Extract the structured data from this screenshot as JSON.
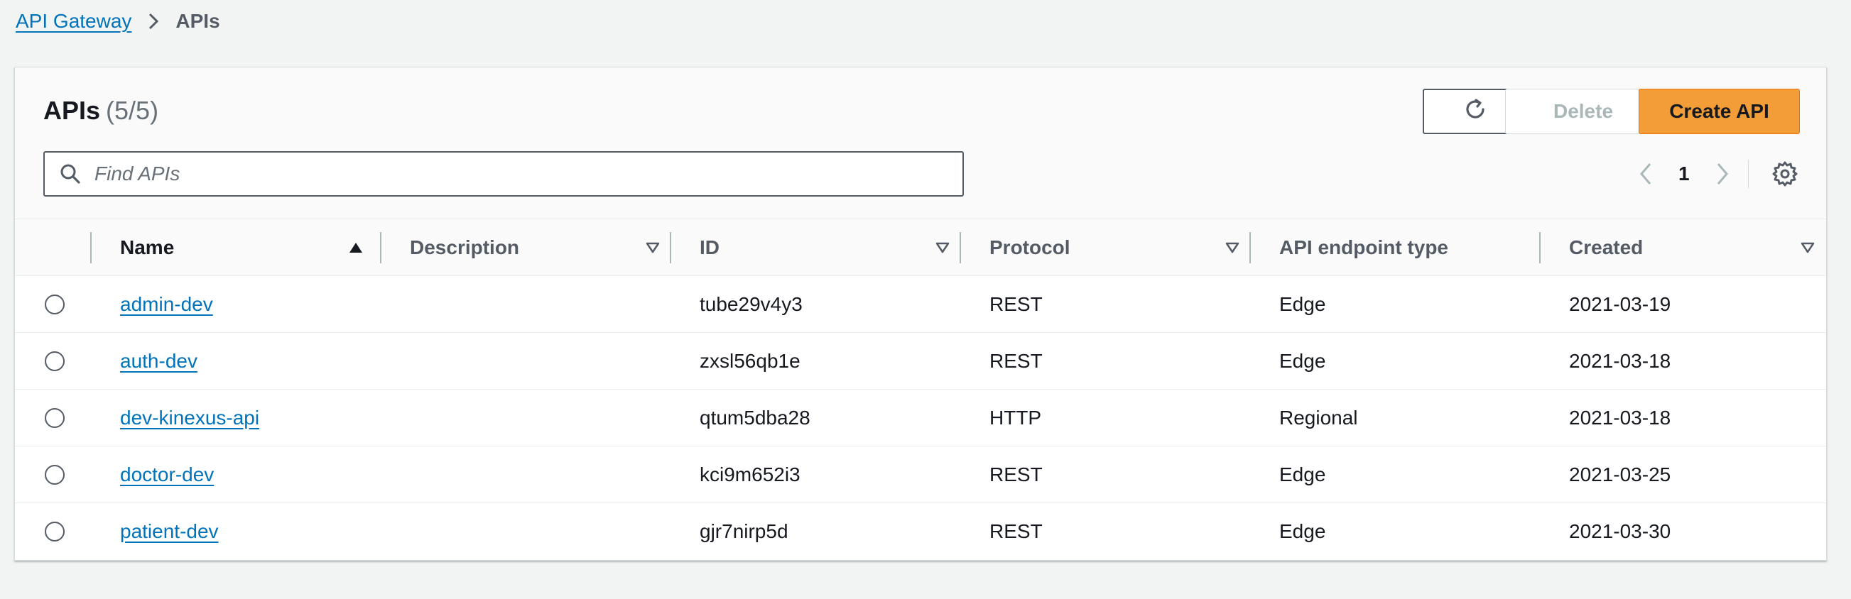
{
  "breadcrumb": {
    "root": "API Gateway",
    "current": "APIs"
  },
  "header": {
    "title": "APIs",
    "count": "(5/5)",
    "refresh_icon": "refresh-icon",
    "delete_label": "Delete",
    "create_label": "Create API"
  },
  "search": {
    "placeholder": "Find APIs",
    "value": ""
  },
  "pagination": {
    "current_page": "1"
  },
  "columns": {
    "name": "Name",
    "description": "Description",
    "id": "ID",
    "protocol": "Protocol",
    "endpoint": "API endpoint type",
    "created": "Created"
  },
  "rows": [
    {
      "name": "admin-dev",
      "description": "",
      "id": "tube29v4y3",
      "protocol": "REST",
      "endpoint": "Edge",
      "created": "2021-03-19"
    },
    {
      "name": "auth-dev",
      "description": "",
      "id": "zxsl56qb1e",
      "protocol": "REST",
      "endpoint": "Edge",
      "created": "2021-03-18"
    },
    {
      "name": "dev-kinexus-api",
      "description": "",
      "id": "qtum5dba28",
      "protocol": "HTTP",
      "endpoint": "Regional",
      "created": "2021-03-18"
    },
    {
      "name": "doctor-dev",
      "description": "",
      "id": "kci9m652i3",
      "protocol": "REST",
      "endpoint": "Edge",
      "created": "2021-03-25"
    },
    {
      "name": "patient-dev",
      "description": "",
      "id": "gjr7nirp5d",
      "protocol": "REST",
      "endpoint": "Edge",
      "created": "2021-03-30"
    }
  ],
  "colors": {
    "link": "#0073bb",
    "primary_button": "#f29d38",
    "background": "#f2f3f3"
  }
}
